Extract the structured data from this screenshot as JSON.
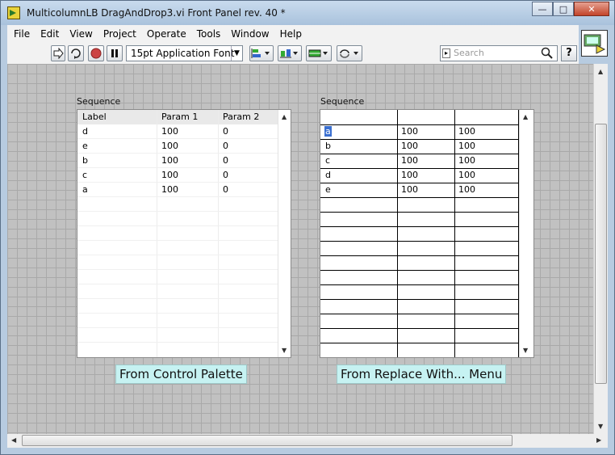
{
  "window": {
    "title": "MulticolumnLB DragAndDrop3.vi Front Panel rev. 40 *",
    "minimize": "—",
    "maximize": "□",
    "close": "✕"
  },
  "menu": {
    "items": [
      {
        "label": "File"
      },
      {
        "label": "Edit"
      },
      {
        "label": "View"
      },
      {
        "label": "Project"
      },
      {
        "label": "Operate"
      },
      {
        "label": "Tools"
      },
      {
        "label": "Window"
      },
      {
        "label": "Help"
      }
    ]
  },
  "toolbar": {
    "font": "15pt Application Font",
    "search_placeholder": "Search",
    "help": "?"
  },
  "left_listbox": {
    "label": "Sequence",
    "headers": [
      "Label",
      "Param 1",
      "Param 2"
    ],
    "rows": [
      [
        "d",
        "100",
        "0"
      ],
      [
        "e",
        "100",
        "0"
      ],
      [
        "b",
        "100",
        "0"
      ],
      [
        "c",
        "100",
        "0"
      ],
      [
        "a",
        "100",
        "0"
      ]
    ],
    "caption": "From Control Palette"
  },
  "right_listbox": {
    "label": "Sequence",
    "rows": [
      [
        "a",
        "100",
        "100"
      ],
      [
        "b",
        "100",
        "100"
      ],
      [
        "c",
        "100",
        "100"
      ],
      [
        "d",
        "100",
        "100"
      ],
      [
        "e",
        "100",
        "100"
      ]
    ],
    "caption": "From Replace With... Menu"
  },
  "colors": {
    "panel_grid": "#c1c1c1",
    "caption_bg": "#c6f2f2",
    "selection": "#3a6fd0"
  }
}
